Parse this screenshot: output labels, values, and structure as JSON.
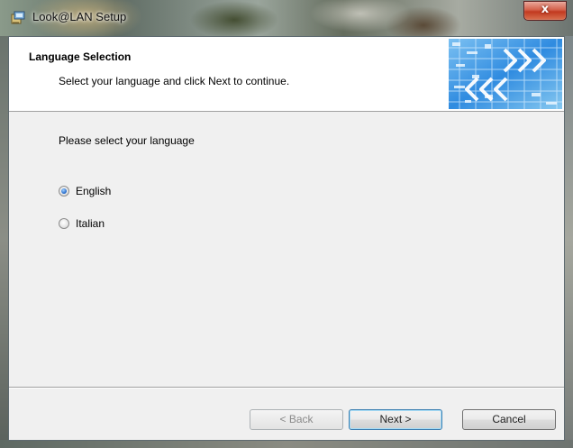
{
  "window": {
    "title": "Look@LAN Setup",
    "close_glyph": "x"
  },
  "header": {
    "title": "Language Selection",
    "subtitle": "Select your language and click Next to continue."
  },
  "body": {
    "prompt": "Please select your language",
    "languages": [
      {
        "label": "English",
        "selected": true
      },
      {
        "label": "Italian",
        "selected": false
      }
    ]
  },
  "buttons": {
    "back": "< Back",
    "next": "Next >",
    "cancel": "Cancel"
  },
  "icons": {
    "app": "installer-icon",
    "banner": "network-arrows-banner",
    "close": "close-icon"
  },
  "colors": {
    "accent": "#1d63c6",
    "close_button": "#c2391f",
    "banner_blue": "#2f8be0"
  }
}
